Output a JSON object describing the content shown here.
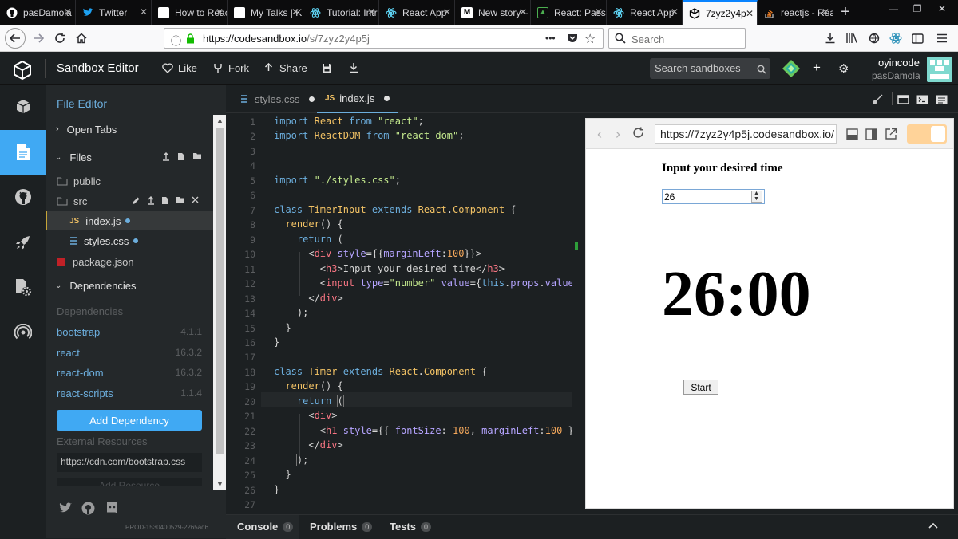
{
  "browser": {
    "tabs": [
      {
        "label": "pasDamola",
        "icon": "github-icon",
        "color": "#ffffff"
      },
      {
        "label": "Twitter",
        "icon": "twitter-icon",
        "color": "#1da1f2"
      },
      {
        "label": "How to Reac",
        "icon": "doc-icon",
        "color": "#ffffff"
      },
      {
        "label": "My Talks | K",
        "icon": "doc-icon",
        "color": "#ffffff"
      },
      {
        "label": "Tutorial: Intr",
        "icon": "react-icon",
        "color": "#61dafb"
      },
      {
        "label": "React App",
        "icon": "react-icon",
        "color": "#61dafb"
      },
      {
        "label": "New story –",
        "icon": "medium-icon",
        "color": "#ffffff"
      },
      {
        "label": "React: Pass",
        "icon": "jsfiddle-icon",
        "color": "#4caf50"
      },
      {
        "label": "React App",
        "icon": "react-icon",
        "color": "#61dafb"
      },
      {
        "label": "7zyz2y4p",
        "icon": "codesandbox-icon",
        "color": "#000000",
        "active": true
      },
      {
        "label": "reactjs - Rea",
        "icon": "stackoverflow-icon",
        "color": "#f48024"
      }
    ],
    "url_host": "https://codesandbox.io",
    "url_path": "/s/7zyz2y4p5j",
    "url_dots": "•••",
    "search_placeholder": "Search"
  },
  "header": {
    "title": "Sandbox Editor",
    "like": "Like",
    "fork": "Fork",
    "share": "Share",
    "search_placeholder": "Search sandboxes",
    "username": "oyincode",
    "handle": "pasDamola"
  },
  "sidebar": {
    "title": "File Editor",
    "open_tabs": "Open Tabs",
    "files": "Files",
    "tree": [
      {
        "label": "public",
        "type": "folder"
      },
      {
        "label": "src",
        "type": "folder"
      },
      {
        "label": "index.js",
        "type": "js"
      },
      {
        "label": "styles.css",
        "type": "css"
      },
      {
        "label": "package.json",
        "type": "npm"
      }
    ],
    "dependencies_heading": "Dependencies",
    "dependencies_label": "Dependencies",
    "dependencies": [
      {
        "name": "bootstrap",
        "version": "4.1.1"
      },
      {
        "name": "react",
        "version": "16.3.2"
      },
      {
        "name": "react-dom",
        "version": "16.3.2"
      },
      {
        "name": "react-scripts",
        "version": "1.1.4"
      }
    ],
    "add_dependency": "Add Dependency",
    "external_resources": "External Resources",
    "external_resource_value": "https://cdn.com/bootstrap.css",
    "add_resource": "Add Resource",
    "build": "PROD-1530400529-2265ad6"
  },
  "editor": {
    "tabs": [
      {
        "label": "styles.css",
        "icon": "css-icon"
      },
      {
        "label": "index.js",
        "icon": "JS"
      }
    ],
    "line_numbers": [
      "1",
      "2",
      "3",
      "4",
      "5",
      "6",
      "7",
      "8",
      "9",
      "10",
      "11",
      "12",
      "13",
      "14",
      "15",
      "16",
      "17",
      "18",
      "19",
      "20",
      "21",
      "22",
      "23",
      "24",
      "25",
      "26",
      "27"
    ]
  },
  "preview": {
    "url": "https://7zyz2y4p5j.codesandbox.io/",
    "heading": "Input your desired time",
    "input_value": "26",
    "timer": "26:00",
    "start": "Start"
  },
  "bottom": {
    "tabs": [
      {
        "label": "Console",
        "count": "0"
      },
      {
        "label": "Problems",
        "count": "0"
      },
      {
        "label": "Tests",
        "count": "0"
      }
    ]
  }
}
